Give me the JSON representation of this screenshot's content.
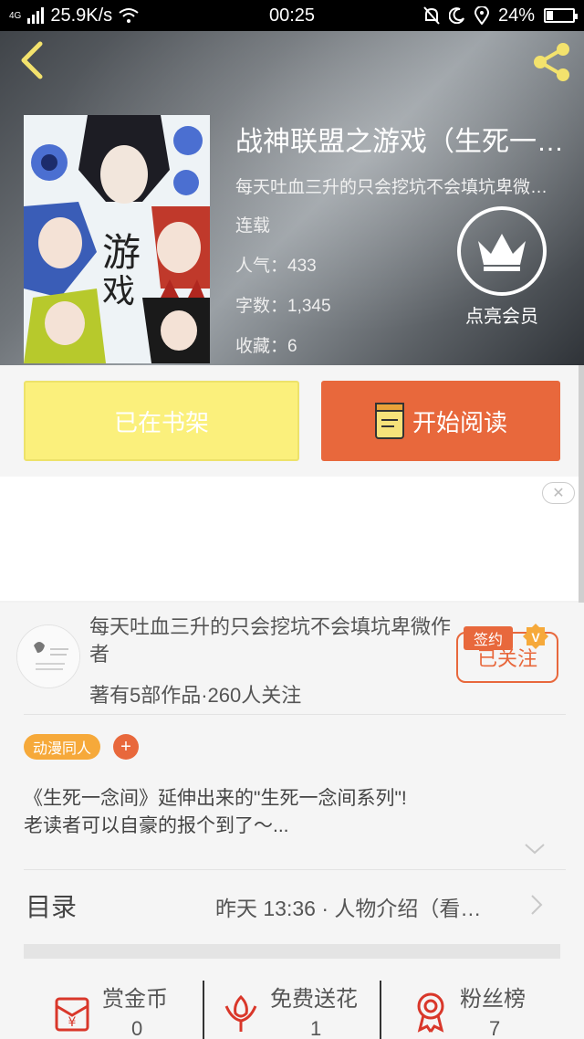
{
  "status_bar": {
    "network_label": "4G",
    "speed": "25.9K/s",
    "time": "00:25",
    "battery": "24%",
    "battery_level": 0.24
  },
  "book": {
    "title": "战神联盟之游戏（生死一…",
    "author": "每天吐血三升的只会挖坑不会填坑卑微…",
    "status": "连载",
    "popularity": "人气：433",
    "word_count": "字数：1,345",
    "favorites": "收藏：6",
    "cover_text_a": "游",
    "cover_text_b": "戏"
  },
  "vip": {
    "label": "点亮会员"
  },
  "actions": {
    "shelf_label": "已在书架",
    "read_label": "开始阅读"
  },
  "ad": {
    "close": "✕"
  },
  "author_card": {
    "name": "每天吐血三升的只会挖坑不会填坑卑微作者",
    "stats": "著有5部作品·260人关注",
    "follow_label": "已关注",
    "sign_label": "签约",
    "v_label": "V"
  },
  "tags": [
    {
      "label": "动漫同人"
    }
  ],
  "tag_add": "+",
  "description": [
    "《生死一念间》延伸出来的\"生死一念间系列\"!",
    "老读者可以自豪的报个到了～..."
  ],
  "catalog": {
    "label": "目录",
    "latest": "昨天 13:36 · 人物介绍（看…"
  },
  "stats": [
    {
      "name": "赏金币",
      "value": "0"
    },
    {
      "name": "免费送花",
      "value": "1"
    },
    {
      "name": "粉丝榜",
      "value": "7"
    }
  ],
  "colors": {
    "accent": "#e8683c",
    "shelf_yellow": "#fbf07c",
    "tag_orange": "#f6a93a",
    "icon_yellow": "#f3e26d"
  },
  "icons": [
    "back-icon",
    "share-icon",
    "crown-icon",
    "book-icon",
    "close-icon",
    "chevron-down-icon",
    "chevron-right-icon",
    "coin-icon",
    "flower-icon",
    "ribbon-icon"
  ]
}
